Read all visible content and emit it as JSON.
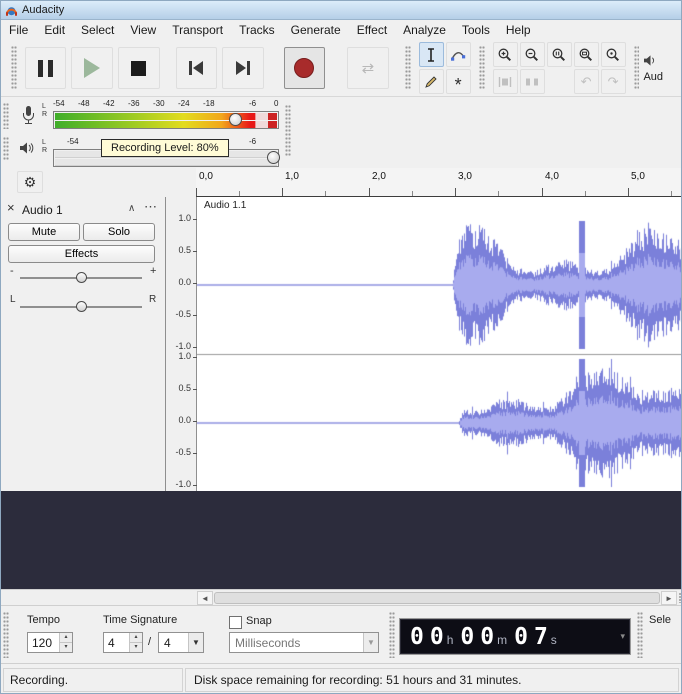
{
  "window": {
    "title": "Audacity"
  },
  "menu": {
    "items": [
      "File",
      "Edit",
      "Select",
      "View",
      "Transport",
      "Tracks",
      "Generate",
      "Effect",
      "Analyze",
      "Tools",
      "Help"
    ]
  },
  "toolbar": {
    "audio_setup_label": "Aud"
  },
  "meters": {
    "tooltip": "Recording Level: 80%",
    "record": {
      "channel_labels": [
        "L",
        "R"
      ],
      "scale": [
        "-54",
        "-48",
        "-42",
        "-36",
        "-30",
        "-24",
        "-18"
      ],
      "scale_right": [
        "-6",
        "0"
      ],
      "level_percent": 80
    },
    "play": {
      "channel_labels": [
        "L",
        "R"
      ],
      "scale_left": "-54",
      "scale_right": "-6"
    }
  },
  "timeline": {
    "second_labels": [
      "0,0",
      "1,0",
      "2,0",
      "3,0",
      "4,0",
      "5,0"
    ]
  },
  "track": {
    "name": "Audio 1",
    "clip_label": "Audio 1.1",
    "mute_label": "Mute",
    "solo_label": "Solo",
    "effects_label": "Effects",
    "gain_min": "-",
    "gain_max": "+",
    "pan_left": "L",
    "pan_right": "R",
    "ruler_values": [
      "1.0",
      "0.5",
      "0.0",
      "-0.5",
      "-1.0"
    ],
    "audio": {
      "channels": 2,
      "onset_sec": [
        2.95,
        3.02
      ],
      "peak_sec": 4.45,
      "view_end_sec": 5.65
    }
  },
  "bottom": {
    "tempo_label": "Tempo",
    "tempo_value": "120",
    "time_signature_label": "Time Signature",
    "time_signature_upper": "4",
    "time_signature_slash": "/",
    "time_signature_lower": "4",
    "snap_label": "Snap",
    "snap_mode": "Milliseconds",
    "time_display": [
      {
        "value": "00",
        "unit": "h"
      },
      {
        "value": "00",
        "unit": "m"
      },
      {
        "value": "07",
        "unit": "s"
      }
    ],
    "selection_label": "Sele"
  },
  "status": {
    "left": "Recording.",
    "right": "Disk space remaining for recording: 51 hours and 31 minutes."
  },
  "colors": {
    "waveform": "#7b80da",
    "waveform_core": "#a8abee",
    "record_button": "#a82b2b",
    "void_bg": "#2c2c3c",
    "titlebar": "#bcd4ec",
    "tooltip_bg": "#fffbd6"
  }
}
